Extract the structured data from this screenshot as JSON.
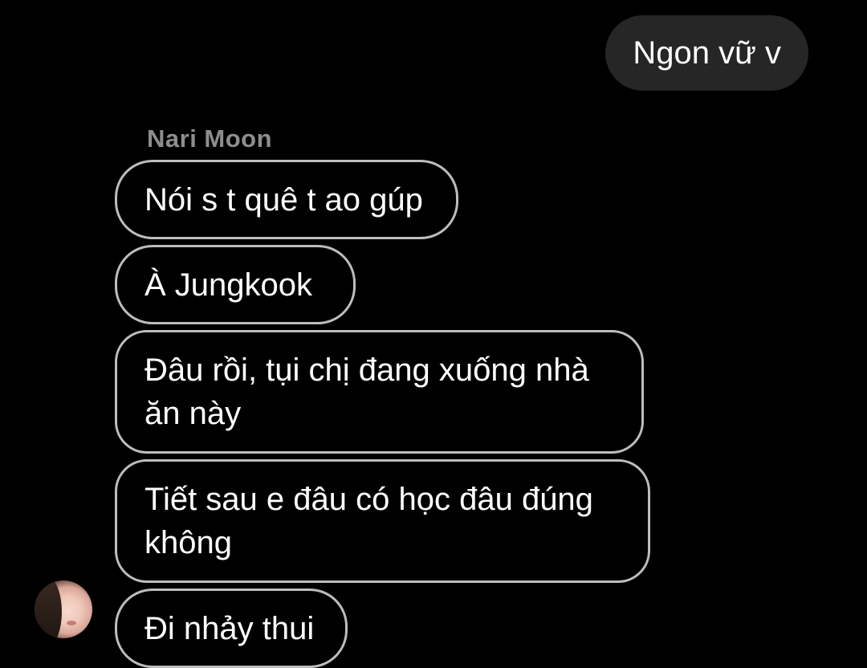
{
  "conversation": {
    "outgoing": [
      {
        "text": "Ngon vữ v"
      }
    ],
    "incoming": {
      "sender_name": "Nari Moon",
      "messages": [
        {
          "text": "Nói s t quê t ao gúp"
        },
        {
          "text": "À Jungkook"
        },
        {
          "text": "Đâu rồi, tụi chị đang xuống nhà ăn này"
        },
        {
          "text": "Tiết sau e đâu có học đâu đúng không"
        },
        {
          "text": "Đi nhảy thui"
        }
      ]
    }
  },
  "colors": {
    "background": "#000000",
    "outgoing_bubble": "#262626",
    "incoming_border": "#bdbdbd",
    "sender_name": "#8e8e8e",
    "text": "#ffffff"
  },
  "icons": {
    "avatar": "avatar-photo"
  }
}
